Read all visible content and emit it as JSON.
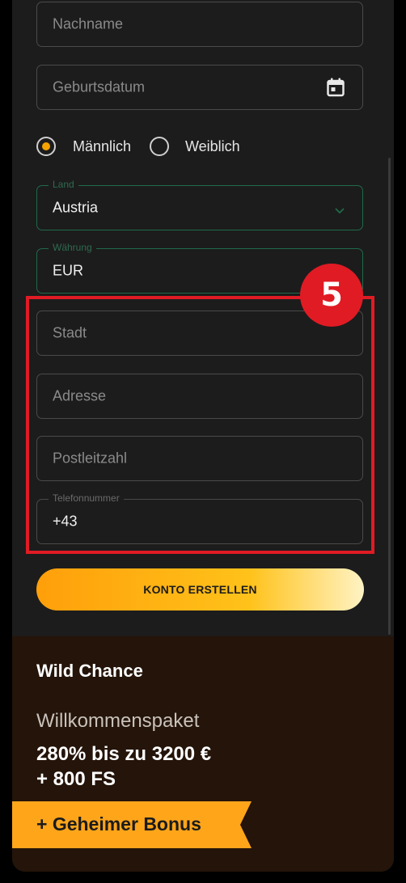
{
  "form": {
    "nachname_placeholder": "Nachname",
    "geburtsdatum_placeholder": "Geburtsdatum",
    "gender_options": [
      "Männlich",
      "Weiblich"
    ],
    "gender_selected": "Männlich",
    "land_label": "Land",
    "land_value": "Austria",
    "waehrung_label": "Währung",
    "waehrung_value": "EUR",
    "stadt_placeholder": "Stadt",
    "adresse_placeholder": "Adresse",
    "postleitzahl_placeholder": "Postleitzahl",
    "telefon_label": "Telefonnummer",
    "telefon_value": "+43",
    "submit_label": "KONTO ERSTELLEN"
  },
  "annotation": {
    "step_number": "5",
    "color": "#e01b24"
  },
  "promo": {
    "brand": "Wild Chance",
    "subtitle": "Willkommenspaket",
    "offer_line1": "280% bis zu 3200 €",
    "offer_line2": "+ 800 FS",
    "ribbon_label": "+ Geheimer Bonus"
  },
  "colors": {
    "accent": "#f5a300",
    "background": "#1c1c1c",
    "promo_background": "#241409",
    "valid_border": "#1f6a4a"
  },
  "icons": [
    "calendar-icon",
    "chevron-down-icon"
  ]
}
